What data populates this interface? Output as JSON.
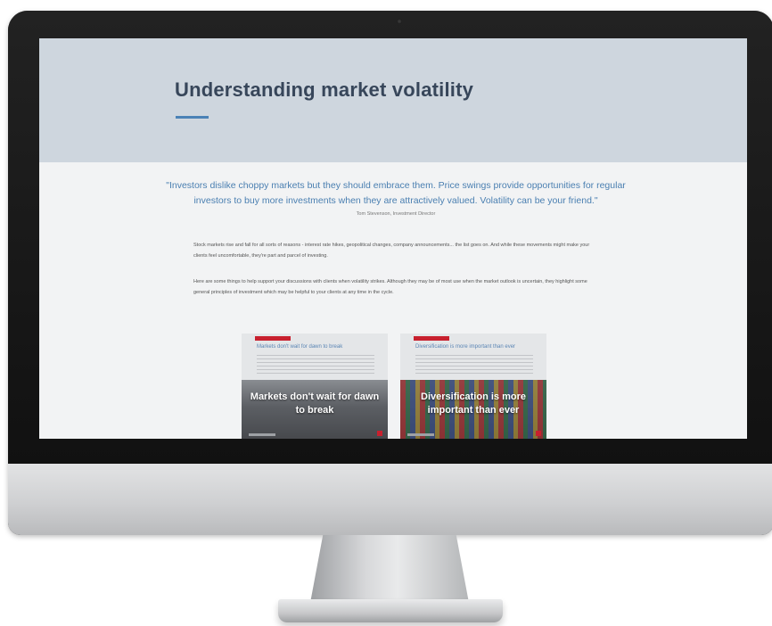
{
  "page": {
    "title": "Understanding market volatility",
    "quote": "\"Investors dislike choppy markets but they should embrace them. Price swings provide opportunities for regular investors to buy more investments when they are attractively valued. Volatility can be your friend.\"",
    "quote_attribution": "Tom Stevenson, Investment Director",
    "paragraphs": [
      "Stock markets rise and fall for all sorts of reasons - interest rate hikes, geopolitical changes, company announcements... the list goes on. And while these movements might make your clients feel uncomfortable, they're part and parcel of investing.",
      "Here are some things to help support your discussions with clients when volatility strikes. Although they may be of most use when the market outlook is uncertain, they highlight some general principles of investment which may be helpful to your clients at any time in the cycle."
    ]
  },
  "cards": [
    {
      "heading": "Markets don't wait for dawn to break",
      "overlay_title": "Markets don't wait for dawn to break"
    },
    {
      "heading": "Diversification is more important than ever",
      "overlay_title": "Diversification is more important than ever"
    }
  ],
  "colors": {
    "hero_background": "#ced6de",
    "title": "#37465a",
    "accent": "#4b82b6",
    "brand_red": "#c8202e"
  }
}
